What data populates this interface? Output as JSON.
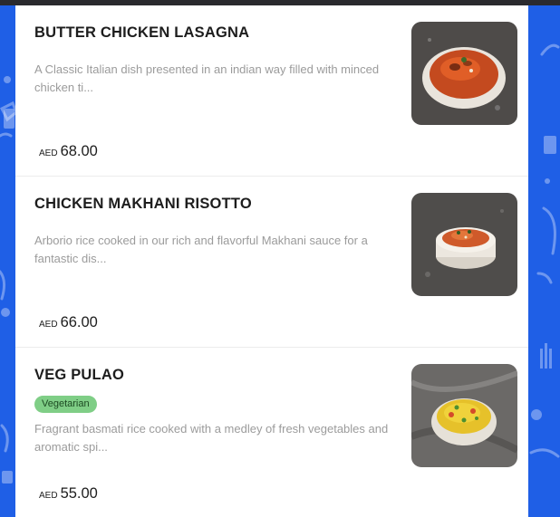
{
  "colors": {
    "background": "#1f5fe6",
    "card": "#ffffff",
    "badge": "#7fce86"
  },
  "menu_items": [
    {
      "name": "BUTTER CHICKEN LASAGNA",
      "description_line1": "A Classic Italian dish presented in an indian way filled with minced",
      "description_line2": "chicken ti...",
      "currency": "AED",
      "price": "68.00",
      "image_icon": "butter-chicken-lasagna-photo"
    },
    {
      "name": "CHICKEN MAKHANI RISOTTO",
      "description_line1": "Arborio rice cooked in our rich and flavorful Makhani sauce for a",
      "description_line2": "fantastic dis...",
      "currency": "AED",
      "price": "66.00",
      "image_icon": "chicken-makhani-risotto-photo"
    },
    {
      "name": "VEG PULAO",
      "badge": "Vegetarian",
      "description_line1": "Fragrant basmati rice cooked with a medley of fresh vegetables and",
      "description_line2": "aromatic spi...",
      "currency": "AED",
      "price": "55.00",
      "image_icon": "veg-pulao-photo"
    }
  ]
}
